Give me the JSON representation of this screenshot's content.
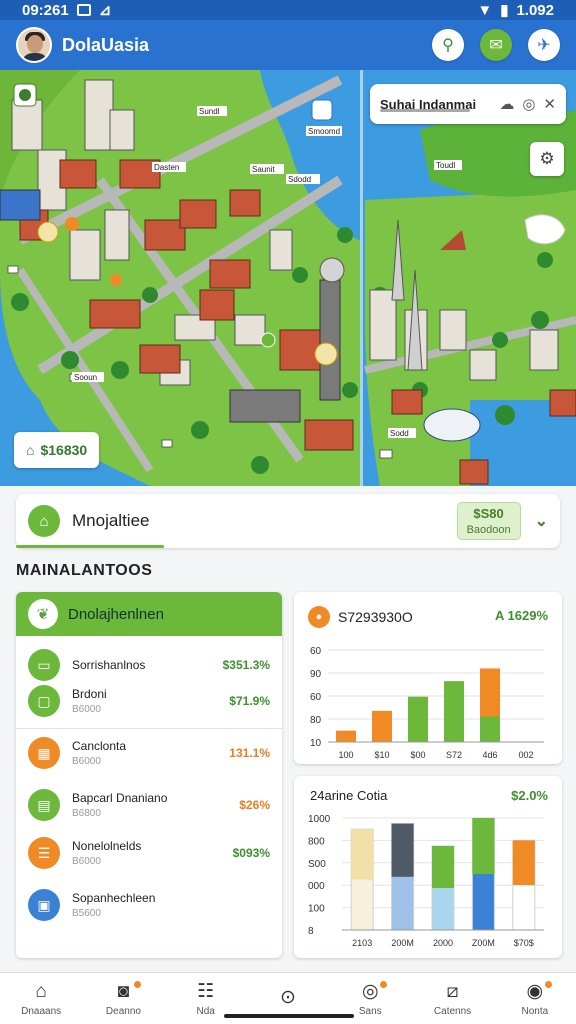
{
  "status": {
    "time": "09:261",
    "battery": "1.092"
  },
  "header": {
    "title": "DolaUasia"
  },
  "map": {
    "search_title": "Suhai Indanmai",
    "price_label": "$16830",
    "labels": [
      "Sundl",
      "Smoomd",
      "Dasten",
      "Saunit",
      "Sdodd",
      "Sooun",
      "Toudl",
      "Sodd"
    ]
  },
  "selector": {
    "title": "Mnojaltiee",
    "badge_value": "$S80",
    "badge_sub": "Baodoon"
  },
  "section_title": "MAINALANTOOS",
  "list": {
    "title": "Dnolajhenlnen",
    "rows": [
      {
        "title": "Sorrishanlnos",
        "sub": "",
        "value": "$351.3%",
        "color": "green",
        "icon": "wallet-icon"
      },
      {
        "title": "Brdoni",
        "sub": "B6000",
        "value": "$71.9%",
        "color": "green",
        "icon": "card-icon"
      },
      {
        "title": "Canclonta",
        "sub": "B6000",
        "value": "131.1%",
        "color": "orange",
        "icon": "calendar-icon"
      },
      {
        "title": "Bapcarl Dnaniano",
        "sub": "B6800",
        "value": "$26%",
        "color": "orange",
        "icon": "document-icon"
      },
      {
        "title": "Nonelolnelds",
        "sub": "B6000",
        "value": "$093%",
        "color": "green",
        "icon": "list-icon"
      },
      {
        "title": "Sopanhechleen",
        "sub": "B5600",
        "value": "",
        "color": "blue",
        "icon": "clipboard-icon"
      }
    ]
  },
  "chart1": {
    "title": "S7293930O",
    "right": "A 1629%"
  },
  "chart2": {
    "title": "24arine Cotia",
    "right": "$2.0%"
  },
  "chart_data": [
    {
      "type": "bar",
      "title": "S7293930O",
      "categories": [
        "100",
        "$10",
        "$00",
        "S72",
        "4d6",
        "002"
      ],
      "series": [
        {
          "values": [
            8,
            22,
            32,
            43,
            52
          ]
        },
        {
          "values": [
            0,
            0,
            0,
            0,
            18
          ]
        }
      ],
      "y_ticks": [
        "60",
        "90",
        "60",
        "80",
        "10"
      ],
      "ylim": [
        0,
        65
      ]
    },
    {
      "type": "bar",
      "title": "24arine Cotia",
      "categories": [
        "2103",
        "200M",
        "2000",
        "Z00M",
        "$70$"
      ],
      "values": [
        90,
        95,
        75,
        100,
        80
      ],
      "y_ticks": [
        "1000",
        "800",
        "S00",
        "000",
        "100",
        "8"
      ],
      "ylim": [
        0,
        100
      ]
    }
  ],
  "nav": [
    {
      "label": "Dnaaans",
      "icon": "home-icon",
      "dot": false
    },
    {
      "label": "Deanno",
      "icon": "camera-icon",
      "dot": true
    },
    {
      "label": "Nda",
      "icon": "stack-icon",
      "dot": false
    },
    {
      "label": "",
      "icon": "pin-icon",
      "dot": false
    },
    {
      "label": "Sans",
      "icon": "target-icon",
      "dot": true
    },
    {
      "label": "Catenns",
      "icon": "chart-icon",
      "dot": false
    },
    {
      "label": "Nonta",
      "icon": "alert-icon",
      "dot": true
    }
  ],
  "colors": {
    "primary": "#2a72d0",
    "accent_green": "#6bb83b",
    "accent_orange": "#f08a24",
    "water": "#3d9be0",
    "land": "#7dc446"
  }
}
